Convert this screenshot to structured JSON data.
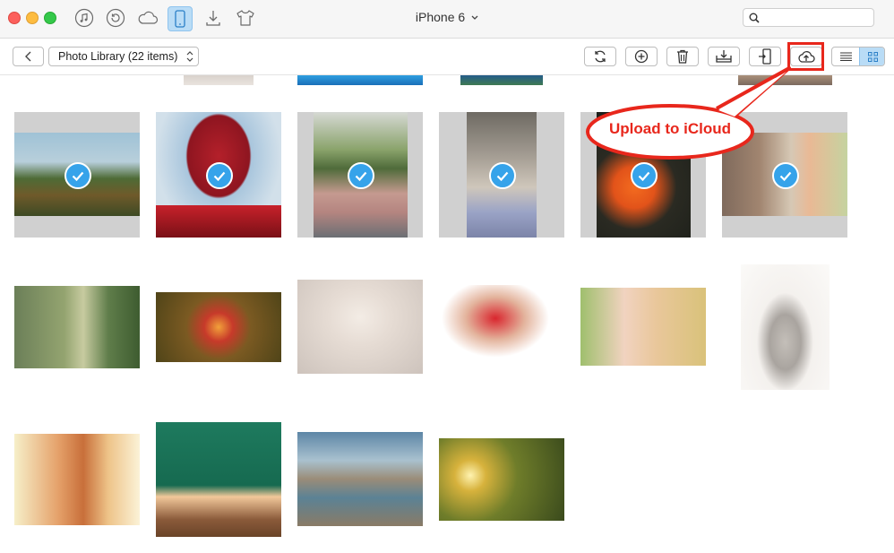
{
  "titlebar": {
    "device_name": "iPhone 6",
    "icons": [
      "music-icon",
      "restore-icon",
      "cloud-icon",
      "phone-icon",
      "download-icon",
      "tshirt-icon"
    ],
    "search_placeholder": ""
  },
  "toolbar": {
    "library_label": "Photo Library (22 items)",
    "buttons": [
      "back",
      "refresh",
      "add",
      "delete",
      "export-to-computer",
      "send-to-device",
      "upload-to-icloud"
    ],
    "view_mode": "grid"
  },
  "callout": {
    "text": "Upload to iCloud"
  },
  "colors": {
    "accent": "#36a3ea",
    "callout_red": "#e8271c",
    "selected_bg": "#b9dcf6"
  },
  "photos": {
    "selected_count": 6
  }
}
